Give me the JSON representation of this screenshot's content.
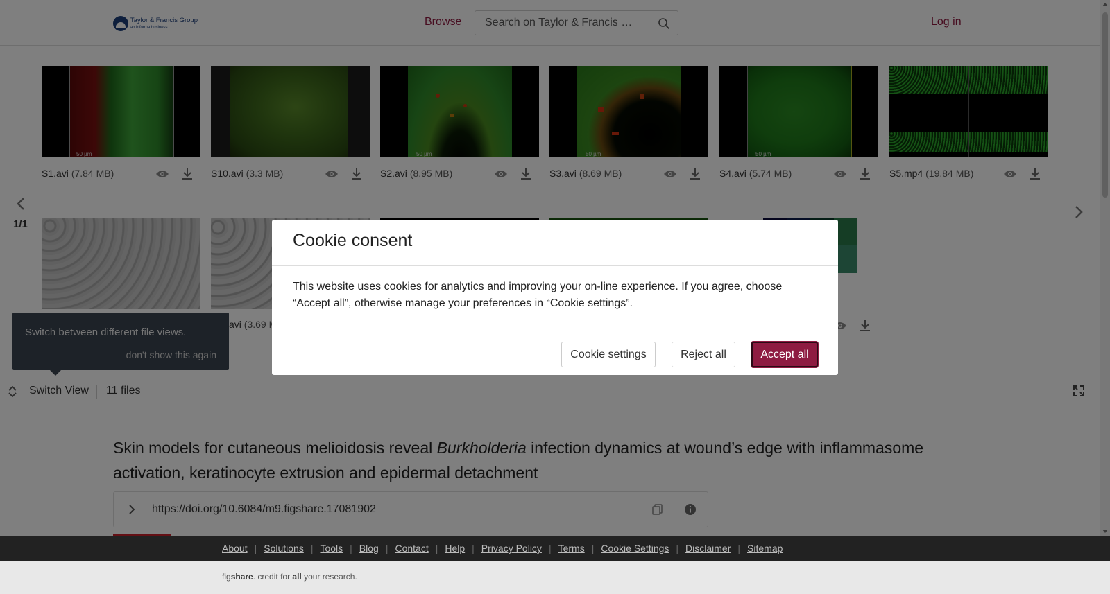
{
  "header": {
    "logo_line1": "Taylor & Francis Group",
    "logo_line2": "an informa business",
    "browse_label": "Browse",
    "search_placeholder": "Search on Taylor & Francis …",
    "login_label": "Log in"
  },
  "gallery": {
    "files": [
      {
        "name": "S1.avi",
        "size": "(7.84 MB)",
        "scale": "50 µm"
      },
      {
        "name": "S10.avi",
        "size": "(3.3 MB)",
        "scale": ""
      },
      {
        "name": "S2.avi",
        "size": "(8.95 MB)",
        "scale": "50 µm"
      },
      {
        "name": "S3.avi",
        "size": "(8.69 MB)",
        "scale": "50 µm"
      },
      {
        "name": "S4.avi",
        "size": "(5.74 MB)",
        "scale": "50 µm"
      },
      {
        "name": "S5.mp4",
        "size": "(19.84 MB)",
        "scale": ""
      },
      {
        "name": "",
        "size": "",
        "scale": ""
      },
      {
        "name": "avi",
        "size": "(3.69 M",
        "scale": ""
      }
    ],
    "pager": "1/1"
  },
  "tooltip": {
    "text": "Switch between different file views.",
    "dismiss": "don't show this again"
  },
  "viewbar": {
    "switch_label": "Switch View",
    "file_count": "11 files"
  },
  "article": {
    "title_part1": "Skin models for cutaneous melioidosis reveal ",
    "title_italic": "Burkholderia",
    "title_part2": " infection dynamics at wound’s edge with inflammasome activation, keratinocyte extrusion and epidermal detachment",
    "doi": "https://doi.org/10.6084/m9.figshare.17081902"
  },
  "cookie": {
    "title": "Cookie consent",
    "body": "This website uses cookies for analytics and improving your on-line experience. If you agree, choose “Accept all”, otherwise manage your preferences in “Cookie settings”.",
    "settings_label": "Cookie settings",
    "reject_label": "Reject all",
    "accept_label": "Accept all"
  },
  "footer": {
    "links": [
      "About",
      "Solutions",
      "Tools",
      "Blog",
      "Contact",
      "Help",
      "Privacy Policy",
      "Terms",
      "Cookie Settings",
      "Disclaimer",
      "Sitemap"
    ],
    "credit_fig": "fig",
    "credit_share": "share",
    "credit_mid": ". credit for ",
    "credit_all": "all",
    "credit_end": " your research."
  },
  "colors": {
    "brand": "#8e1b41",
    "overlay": "rgba(0,0,0,0.5)"
  }
}
